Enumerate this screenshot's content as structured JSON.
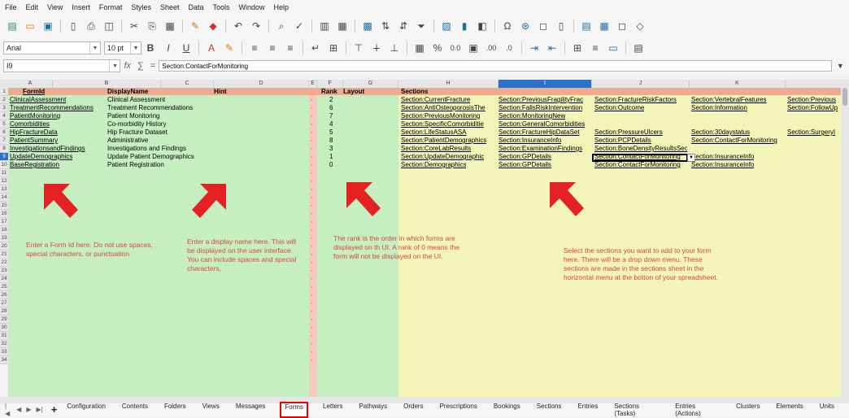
{
  "menu": [
    "File",
    "Edit",
    "View",
    "Insert",
    "Format",
    "Styles",
    "Sheet",
    "Data",
    "Tools",
    "Window",
    "Help"
  ],
  "toolbar": {
    "font_name": "Arial",
    "font_size": "10 pt",
    "bold": "B",
    "italic": "I",
    "underline": "U",
    "percent": "%",
    "decimal": "0.0",
    "dec_add": ".00",
    "dec_del": ".0",
    "omega": "Ω"
  },
  "formula_bar": {
    "cell_ref": "I9",
    "fx": "fx",
    "sum": "∑",
    "eq": "=",
    "content": "Section:ContactForMonitoring"
  },
  "columns": [
    "A",
    "B",
    "C",
    "D",
    "E",
    "F",
    "G",
    "H",
    "I",
    "J",
    "K"
  ],
  "headers": {
    "form_id": "FormId",
    "display_name": "DisplayName",
    "hint": "Hint",
    "rank": "Rank",
    "layout": "Layout",
    "sections": "Sections"
  },
  "rows": [
    {
      "form_id": "ClinicalAssessment",
      "display_name": "Clinical Assessment",
      "rank": "2",
      "g": "Section:CurrentFracture",
      "h": "Section:PreviousFragilityFrac",
      "i": "Section:FractureRiskFactors",
      "j": "Section:VertebralFeatures",
      "k": "Section:Previous"
    },
    {
      "form_id": "TreatmentRecommendations",
      "display_name": "Treatment Recommendations",
      "rank": "6",
      "g": "Section:AntiOsteoporosisThe",
      "h": "Section:FallsRiskIntervention",
      "i": "Section:Outcome",
      "j": "Section:Information",
      "k": "Section:FollowUp"
    },
    {
      "form_id": "PatientMonitoring",
      "display_name": "Patient Monitoring",
      "rank": "7",
      "g": "Section:PreviousMonitoring",
      "h": "Section:MonitoringNew",
      "i": "",
      "j": "",
      "k": ""
    },
    {
      "form_id": "Comorbidities",
      "display_name": "Co-morbidity History",
      "rank": "4",
      "g": "Section:SpecificComorbiditie",
      "h": "Section:GeneralComorbidities",
      "i": "",
      "j": "",
      "k": ""
    },
    {
      "form_id": "HipFractureData",
      "display_name": "Hip Fracture Dataset",
      "rank": "5",
      "g": "Section:LifeStatusASA",
      "h": "Section:FractureHipDataSet",
      "i": "Section:PressureUlcers",
      "j": "Section:30daystatus",
      "k": "Section:SurgeryI"
    },
    {
      "form_id": "PatientSummary",
      "display_name": "Administrative",
      "rank": "8",
      "g": "Section:PatientDemographics",
      "h": "Section:InsuranceInfo",
      "i": "Section:PCPDetails",
      "j": "Section:ContactForMonitoring",
      "k": ""
    },
    {
      "form_id": "InvestigationsandFindings",
      "display_name": "Investigations and Findings",
      "rank": "3",
      "g": "Section:CoreLabResults",
      "h": "Section:ExaminationFindings",
      "i": "Section:BoneDensityResultsSection",
      "j": "",
      "k": ""
    },
    {
      "form_id": "UpdateDemographics",
      "display_name": "Update Patient Demographics",
      "rank": "1",
      "g": "Section:UpdateDemographic",
      "h": "Section:GPDetails",
      "i": "Section:ContactForMonitoring",
      "j": "Section:InsuranceInfo",
      "k": ""
    },
    {
      "form_id": "BaseRegistration",
      "display_name": "Patient Registration",
      "rank": "0",
      "g": "Section:Demographics",
      "h": "Section:GPDetails",
      "i": "Section:ContactForMonitoring",
      "j": "Section:InsuranceInfo",
      "k": ""
    }
  ],
  "row_numbers": [
    "1",
    "2",
    "3",
    "4",
    "5",
    "6",
    "7",
    "8",
    "9",
    "10",
    "11",
    "12",
    "13",
    "14",
    "15",
    "16",
    "17",
    "18",
    "19",
    "20",
    "21",
    "22",
    "23",
    "24",
    "25",
    "26",
    "27",
    "28",
    "29",
    "30",
    "31",
    "32",
    "33",
    "34"
  ],
  "dash": "-",
  "notes": {
    "form_id": "Enter a Form Id here. Do not use spaces, special characters, or punctuation",
    "display_name": "Enter a display name here. This will be displayed on the user interface. You can include spaces and special characters,",
    "rank": "The rank is the order in which forms are displayed on th UI. A rank of 0 means the form will not be displayed on the UI.",
    "sections": "Select the sections you want to add to your form here. There will be a drop down menu. These sections are made in the sections sheet in the horizontal menu at the botton of your spreadsheet."
  },
  "sheet_tabs": [
    "Configuration",
    "Contents",
    "Folders",
    "Views",
    "Messages",
    "Forms",
    "Letters",
    "Pathways",
    "Orders",
    "Prescriptions",
    "Bookings",
    "Sections",
    "Entries",
    "Sections (Tasks)",
    "Entries (Actions)",
    "Clusters",
    "Elements",
    "Units"
  ],
  "active_tab": "Forms",
  "colors": {
    "header_row": "#f2a98c",
    "green": "#c5efc0",
    "yellow": "#f2f4b8",
    "note": "#dd4444",
    "selection": "#2a72c9"
  }
}
